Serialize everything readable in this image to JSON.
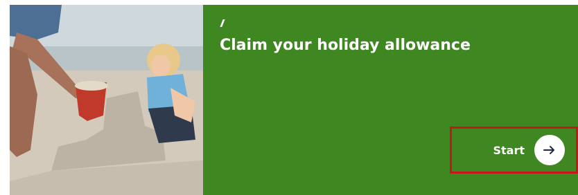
{
  "card": {
    "decoration": "///////",
    "title": "Claim your holiday allowance",
    "start_label": "Start",
    "photo_icon": "beach-photo",
    "arrow_icon": "arrow-right-icon"
  },
  "colors": {
    "panel_green": "#3f8721",
    "highlight_red": "#c4161c",
    "arrow_navy": "#1f2a44"
  }
}
